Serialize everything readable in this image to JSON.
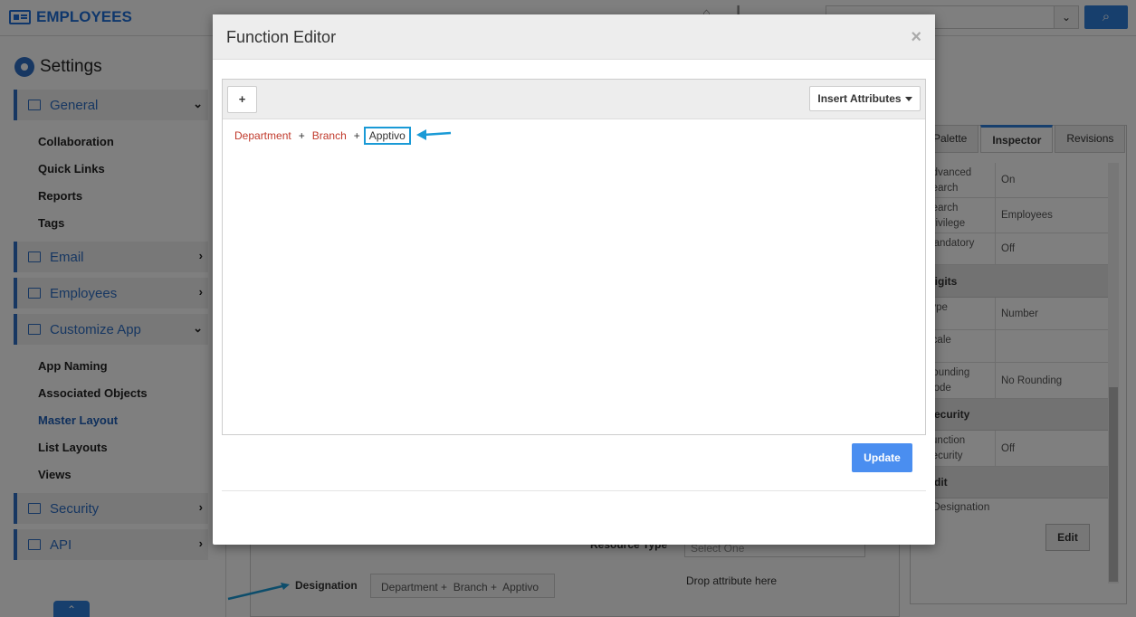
{
  "app": {
    "title": "EMPLOYEES",
    "search_dropdown_icon": "chevron-down-icon",
    "search_button_icon": "search-icon"
  },
  "sidebar": {
    "heading": "Settings",
    "sections": [
      {
        "label": "General",
        "icon": "monitor-icon",
        "chevron": "⌄"
      },
      {
        "label": "Email",
        "icon": "envelope-icon",
        "chevron": "›"
      },
      {
        "label": "Employees",
        "icon": "card-icon",
        "chevron": "›"
      },
      {
        "label": "Customize App",
        "icon": "tools-icon",
        "chevron": "⌄"
      },
      {
        "label": "Security",
        "icon": "lock-icon",
        "chevron": "›"
      },
      {
        "label": "API",
        "icon": "plug-icon",
        "chevron": "›"
      }
    ],
    "general_items": [
      "Collaboration",
      "Quick Links",
      "Reports",
      "Tags"
    ],
    "customize_items": [
      "App Naming",
      "Associated Objects",
      "Master Layout",
      "List Layouts",
      "Views"
    ]
  },
  "layout_canvas": {
    "resource_type_label": "Resource Type",
    "resource_type_placeholder": "Select One",
    "designation_label": "Designation",
    "designation_value": "Department +  Branch +  Apptivo",
    "drop_hint": "Drop attribute here"
  },
  "inspector": {
    "tabs": [
      "Palette",
      "Inspector",
      "Revisions"
    ],
    "rows": [
      {
        "key": "Advanced Search",
        "value": "On"
      },
      {
        "key": "Search Privilege",
        "value": "Employees"
      },
      {
        "key": "Mandatory",
        "value": "Off"
      },
      {
        "key": "Type",
        "value": "Number"
      },
      {
        "key": "Scale",
        "value": ""
      },
      {
        "key": "Rounding Mode",
        "value": "No Rounding"
      },
      {
        "key": "Function Security",
        "value": "Off"
      }
    ],
    "sections": [
      "Digits",
      "Security",
      "Edit"
    ],
    "designation": "Designation",
    "edit_button": "Edit"
  },
  "modal": {
    "title": "Function Editor",
    "close": "×",
    "plus_label": "+",
    "insert_label": "Insert Attributes",
    "expression": {
      "attr1": "Department",
      "op1": "+",
      "attr2": "Branch",
      "op2": "+",
      "literal": "Apptivo"
    },
    "update_label": "Update"
  },
  "colors": {
    "accent": "#2f7fdb",
    "attribute_token": "#c0392b",
    "highlight": "#1a9ad6",
    "update_button": "#4a8ef0"
  }
}
